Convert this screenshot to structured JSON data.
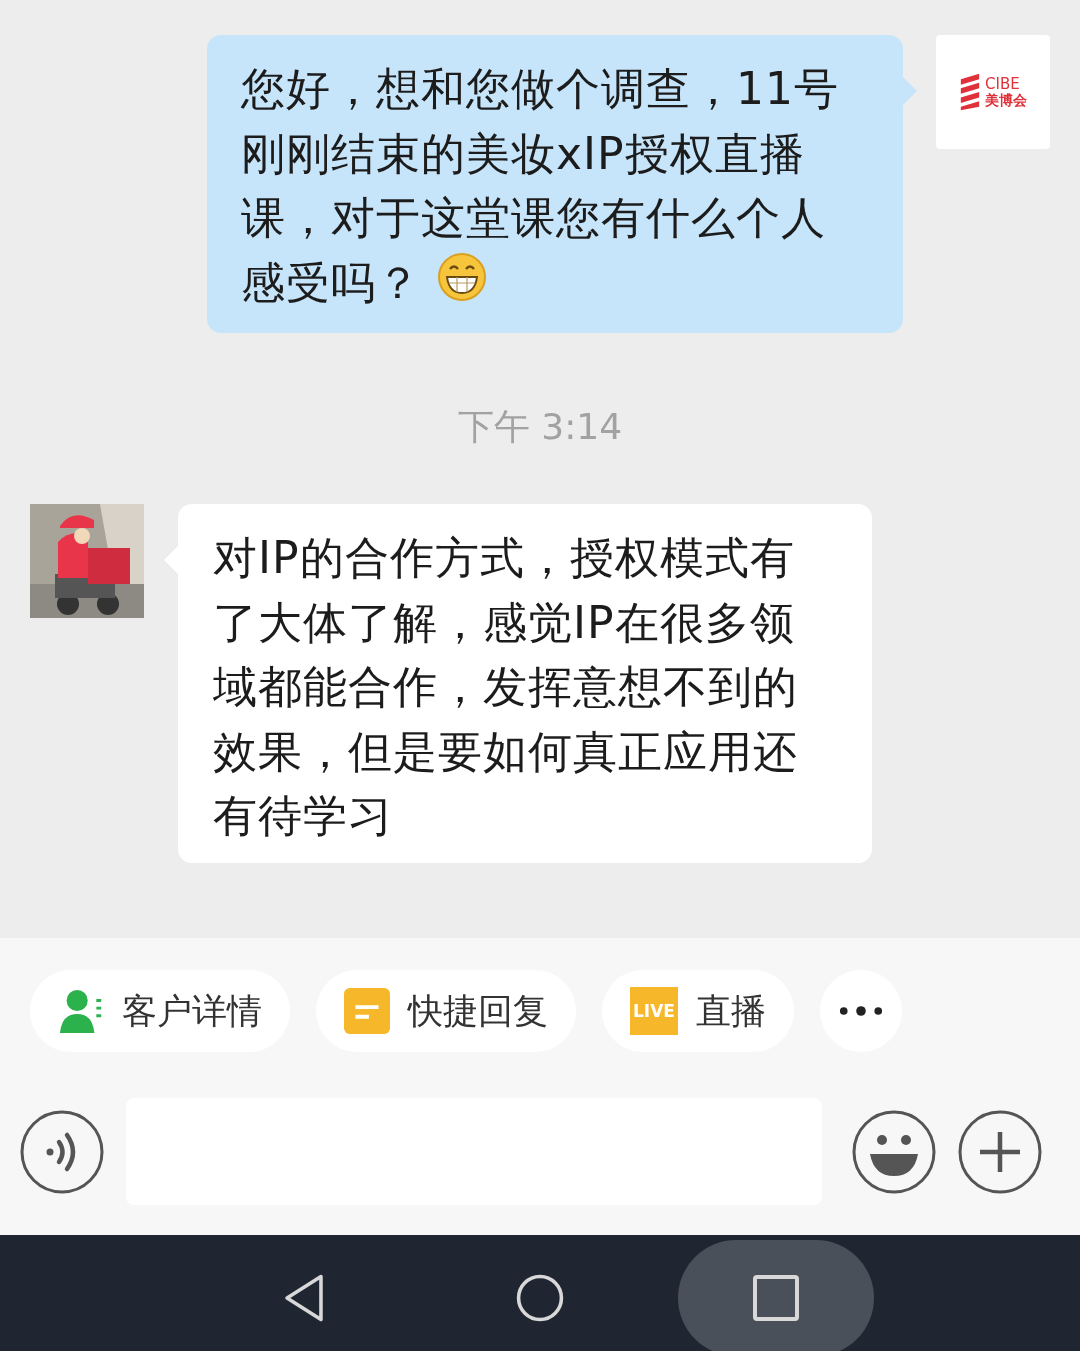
{
  "messages": [
    {
      "kind": "sent",
      "text": "您好，想和您做个调查，11号刚刚结束的美妆xIP授权直播课，对于这堂课您有什么个人感受吗？",
      "emoji": true,
      "avatar": {
        "logo_text": "CIBE",
        "logo_subtext": "美博会"
      }
    },
    {
      "kind": "time",
      "text": "下午 3:14"
    },
    {
      "kind": "received",
      "text": "对IP的合作方式，授权模式有了大体了解，感觉IP在很多领域都能合作，发挥意想不到的效果，但是要如何真正应用还有待学习"
    }
  ],
  "quick_actions": [
    {
      "kind": "customer",
      "label": "客户详情"
    },
    {
      "kind": "reply",
      "label": "快捷回复"
    },
    {
      "kind": "live",
      "label": "直播",
      "badge": "LIVE"
    },
    {
      "kind": "more"
    }
  ],
  "nav_bar": [
    {
      "kind": "back",
      "pressed": false
    },
    {
      "kind": "home",
      "pressed": false
    },
    {
      "kind": "recents",
      "pressed": true
    }
  ]
}
